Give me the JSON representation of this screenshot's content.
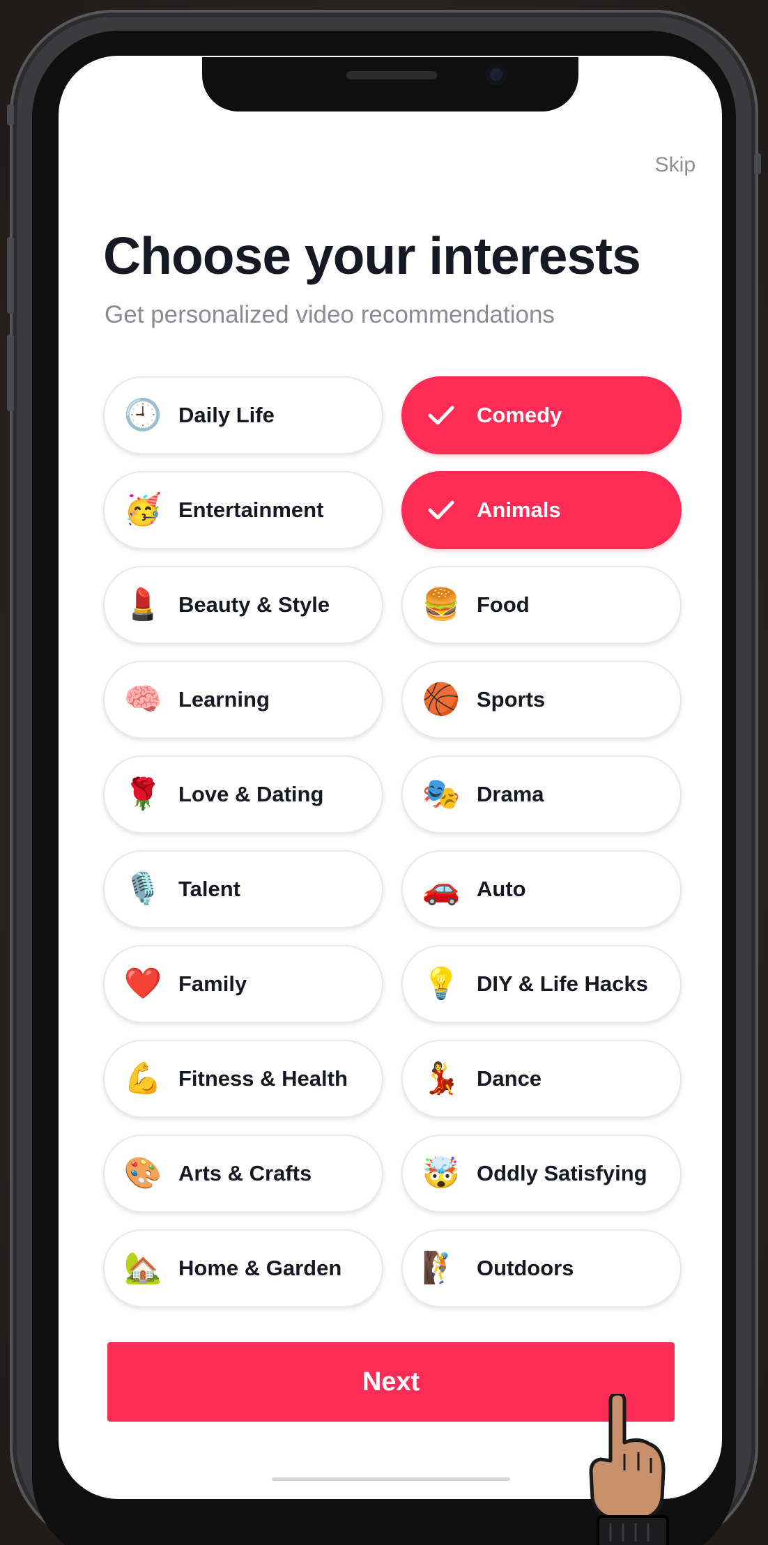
{
  "header": {
    "skip_label": "Skip",
    "title": "Choose your interests",
    "subtitle": "Get personalized video recommendations"
  },
  "accent_color": "#fe2c55",
  "interests": [
    {
      "label": "Daily Life",
      "emoji": "🕘",
      "icon": "clock-icon",
      "selected": false
    },
    {
      "label": "Comedy",
      "emoji": "",
      "icon": "check-icon",
      "selected": true
    },
    {
      "label": "Entertainment",
      "emoji": "🥳",
      "icon": "party-face-icon",
      "selected": false
    },
    {
      "label": "Animals",
      "emoji": "",
      "icon": "check-icon",
      "selected": true
    },
    {
      "label": "Beauty & Style",
      "emoji": "💄",
      "icon": "lipstick-icon",
      "selected": false
    },
    {
      "label": "Food",
      "emoji": "🍔",
      "icon": "burger-icon",
      "selected": false
    },
    {
      "label": "Learning",
      "emoji": "🧠",
      "icon": "brain-icon",
      "selected": false
    },
    {
      "label": "Sports",
      "emoji": "🏀",
      "icon": "basketball-icon",
      "selected": false
    },
    {
      "label": "Love & Dating",
      "emoji": "🌹",
      "icon": "rose-icon",
      "selected": false
    },
    {
      "label": "Drama",
      "emoji": "🎭",
      "icon": "theater-masks-icon",
      "selected": false
    },
    {
      "label": "Talent",
      "emoji": "🎙️",
      "icon": "microphone-icon",
      "selected": false
    },
    {
      "label": "Auto",
      "emoji": "🚗",
      "icon": "car-icon",
      "selected": false
    },
    {
      "label": "Family",
      "emoji": "❤️",
      "icon": "heart-icon",
      "selected": false
    },
    {
      "label": "DIY & Life Hacks",
      "emoji": "💡",
      "icon": "lightbulb-icon",
      "selected": false
    },
    {
      "label": "Fitness & Health",
      "emoji": "💪",
      "icon": "flexed-biceps-icon",
      "selected": false
    },
    {
      "label": "Dance",
      "emoji": "💃",
      "icon": "dancer-icon",
      "selected": false
    },
    {
      "label": "Arts & Crafts",
      "emoji": "🎨",
      "icon": "palette-icon",
      "selected": false
    },
    {
      "label": "Oddly Satisfying",
      "emoji": "🤯",
      "icon": "exploding-head-icon",
      "selected": false
    },
    {
      "label": "Home & Garden",
      "emoji": "🏡",
      "icon": "house-garden-icon",
      "selected": false
    },
    {
      "label": "Outdoors",
      "emoji": "🧗",
      "icon": "climber-icon",
      "selected": false
    }
  ],
  "next_label": "Next"
}
